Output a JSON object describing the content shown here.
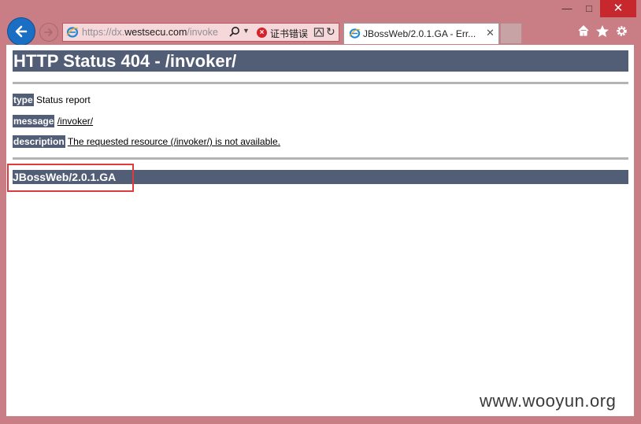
{
  "window": {
    "minimize_glyph": "—",
    "maximize_glyph": "□",
    "close_glyph": "✕"
  },
  "address_bar": {
    "url_prefix": "https://dx.",
    "url_host": "westsecu.com",
    "url_suffix": "/invoke",
    "certificate_error_label": "证书错误"
  },
  "tab": {
    "title": "JBossWeb/2.0.1.GA - Err...",
    "close_glyph": "✕"
  },
  "page": {
    "heading": "HTTP Status 404 - /invoker/",
    "rows": [
      {
        "label": "type",
        "value": "Status report"
      },
      {
        "label": "message",
        "value": "/invoker/"
      },
      {
        "label": "description",
        "value": "The requested resource (/invoker/) is not available."
      }
    ],
    "footer": "JBossWeb/2.0.1.GA"
  },
  "watermark": "www.wooyun.org",
  "icons": [
    "back-arrow-icon",
    "forward-arrow-icon",
    "ie-logo-icon",
    "search-icon",
    "dropdown-icon",
    "certificate-error-icon",
    "compatibility-view-icon",
    "refresh-icon",
    "home-icon",
    "favorites-star-icon",
    "settings-gear-icon"
  ],
  "colors": {
    "frame": "#c97d84",
    "heading_bg": "#525d76",
    "highlight_box": "#e23a3a",
    "back_button": "#1a6fc4",
    "close_button": "#c7282d"
  }
}
